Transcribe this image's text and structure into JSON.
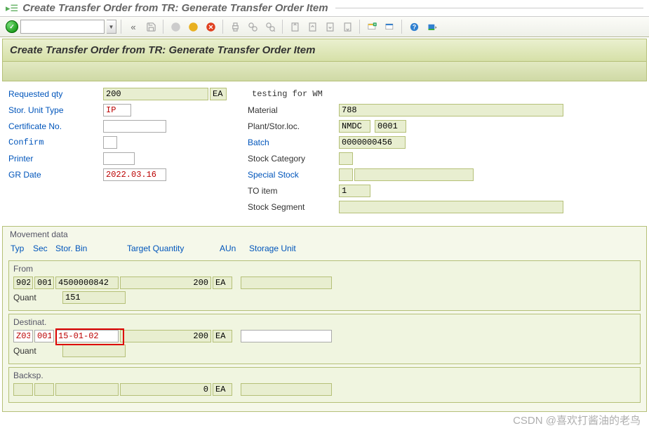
{
  "window_title": "Create Transfer Order from TR: Generate Transfer Order Item",
  "page_header": "Create Transfer Order from TR: Generate Transfer Order Item",
  "toolbar": {
    "command_value": ""
  },
  "labels": {
    "requested_qty": "Requested qty",
    "stor_unit_type": "Stor. Unit Type",
    "certificate_no": "Certificate No.",
    "confirm": "Confirm",
    "printer": "Printer",
    "gr_date": "GR Date",
    "testing": "testing for WM",
    "material": "Material",
    "plant_stor": "Plant/Stor.loc.",
    "batch": "Batch",
    "stock_category": "Stock Category",
    "special_stock": "Special Stock",
    "to_item": "TO item",
    "stock_segment": "Stock Segment",
    "movement_data": "Movement data",
    "from": "From",
    "destinat": "Destinat.",
    "backsp": "Backsp.",
    "quant": "Quant"
  },
  "col_headers": {
    "typ": "Typ",
    "sec": "Sec",
    "bin": "Stor. Bin",
    "qty": "Target Quantity",
    "aun": "AUn",
    "su": "Storage Unit"
  },
  "fields": {
    "requested_qty": "200",
    "requested_qty_uom": "EA",
    "stor_unit_type": "IP",
    "certificate_no": "",
    "confirm": "",
    "printer": "",
    "gr_date": "2022.03.16",
    "material": "788",
    "plant": "NMDC",
    "stor_loc": "0001",
    "batch": "0000000456",
    "stock_category": "",
    "special_stock_ind": "",
    "special_stock_num": "",
    "to_item": "1",
    "stock_segment": ""
  },
  "from": {
    "typ": "902",
    "sec": "001",
    "bin": "4500000842",
    "qty": "200",
    "aun": "EA",
    "su": "",
    "quant": "151"
  },
  "dest": {
    "typ": "Z03",
    "sec": "001",
    "bin": "15-01-02",
    "qty": "200",
    "aun": "EA",
    "su": "",
    "quant": ""
  },
  "backsp": {
    "typ": "",
    "sec": "",
    "bin": "",
    "qty": "0",
    "aun": "EA",
    "su": ""
  },
  "watermark": "CSDN @喜欢打酱油的老鸟"
}
